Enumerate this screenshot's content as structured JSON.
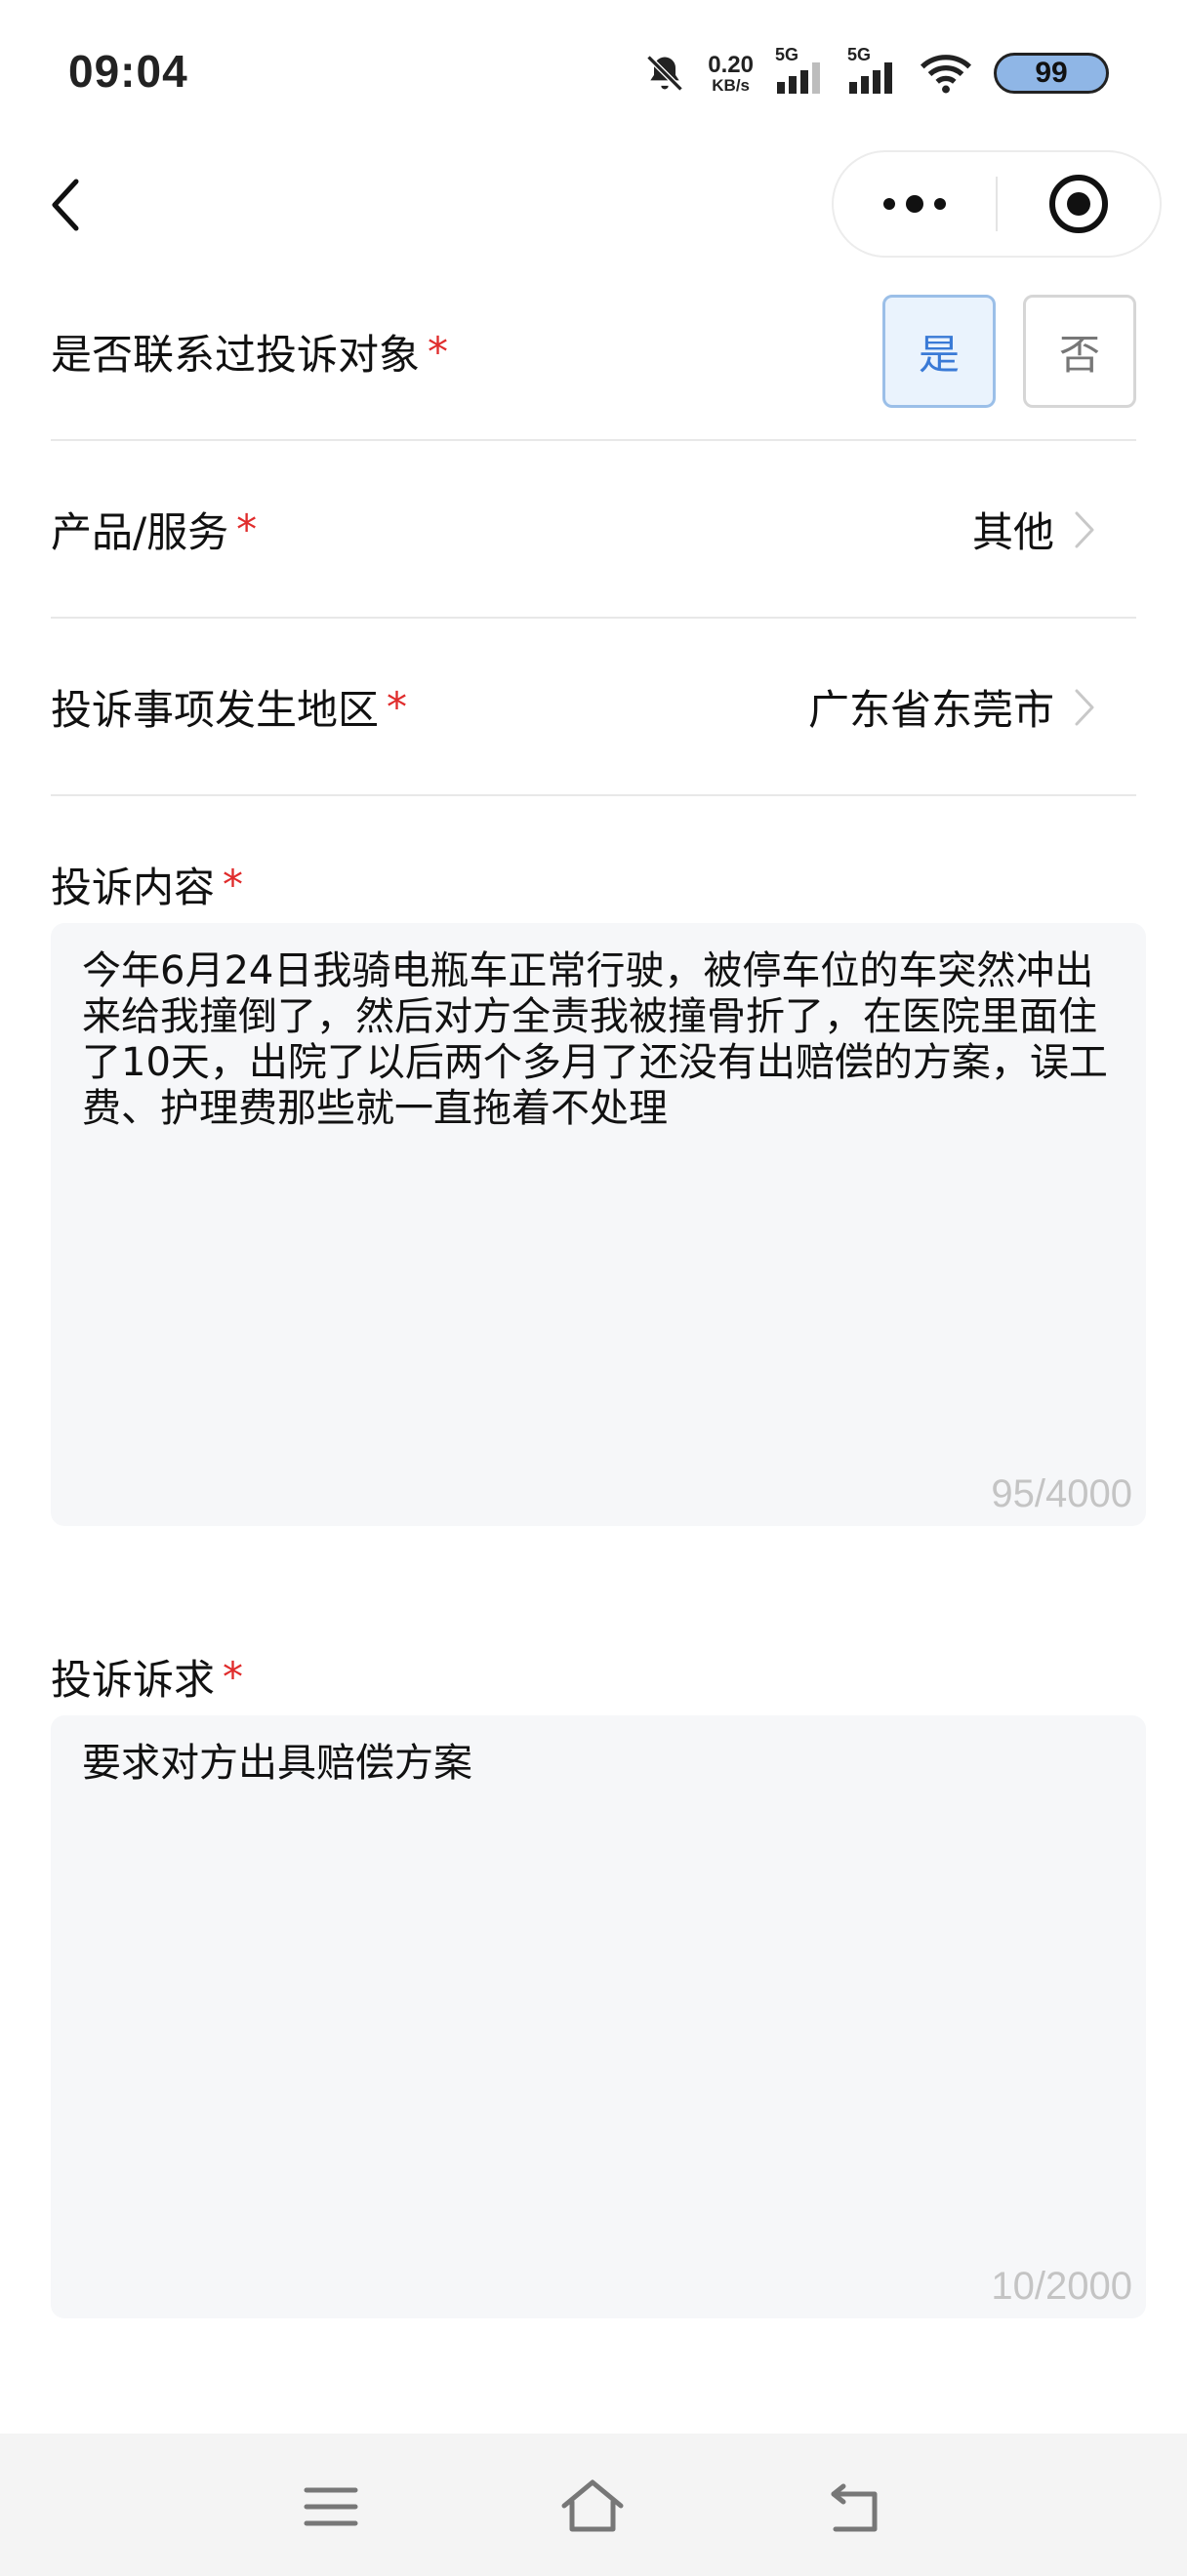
{
  "status_bar": {
    "time": "09:04",
    "net_speed_value": "0.20",
    "net_speed_unit": "KB/s",
    "sim1_label": "5G",
    "sim2_label": "5G",
    "battery": "99"
  },
  "form": {
    "contacted": {
      "label": "是否联系过投诉对象",
      "required_mark": "*",
      "yes_label": "是",
      "no_label": "否",
      "selected": "是"
    },
    "product": {
      "label": "产品/服务",
      "required_mark": "*",
      "value": "其他"
    },
    "region": {
      "label": "投诉事项发生地区",
      "required_mark": "*",
      "value": "广东省东莞市"
    },
    "content": {
      "label": "投诉内容",
      "required_mark": "*",
      "text": "今年6月24日我骑电瓶车正常行驶，被停车位的车突然冲出来给我撞倒了，然后对方全责我被撞骨折了，在医院里面住了10天，出院了以后两个多月了还没有出赔偿的方案，误工费、护理费那些就一直拖着不处理",
      "counter": "95/4000"
    },
    "demand": {
      "label": "投诉诉求",
      "required_mark": "*",
      "text": "要求对方出具赔偿方案",
      "counter": "10/2000"
    }
  },
  "colors": {
    "accent": "#3a7ad6",
    "required": "#e02c2c",
    "textbox_bg": "#f6f7f9",
    "battery_fill": "#8fb6e6"
  },
  "icons": {
    "back": "chevron-left-icon",
    "more": "more-dots-icon",
    "close_miniprogram": "target-icon",
    "bell_muted": "bell-off-icon",
    "wifi": "wifi-icon",
    "nav_menu": "menu-icon",
    "nav_home": "home-icon",
    "nav_back": "return-icon"
  }
}
